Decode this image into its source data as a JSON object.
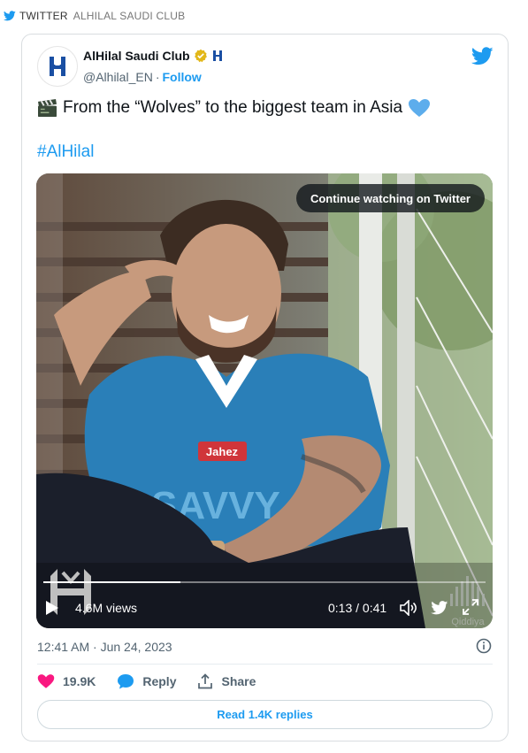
{
  "header": {
    "source": "TWITTER",
    "account": "ALHILAL SAUDI CLUB"
  },
  "tweet": {
    "display_name": "AlHilal Saudi Club",
    "handle": "@Alhilal_EN",
    "separator": "·",
    "follow_label": "Follow",
    "text": "From the “Wolves” to the biggest team in Asia",
    "hashtag": "#AlHilal",
    "timestamp": "12:41 AM · Jun 24, 2023"
  },
  "video": {
    "overlay_button": "Continue watching on Twitter",
    "views": "4.6M views",
    "time": "0:13 / 0:41",
    "progress": 0.31,
    "watermark": "Qiddiya"
  },
  "actions": {
    "likes": "19.9K",
    "reply_label": "Reply",
    "share_label": "Share",
    "read_replies": "Read 1.4K replies"
  },
  "colors": {
    "twitter_blue": "#1d9bf0",
    "heart": "#f91880",
    "jersey": "#2a7fb8"
  }
}
